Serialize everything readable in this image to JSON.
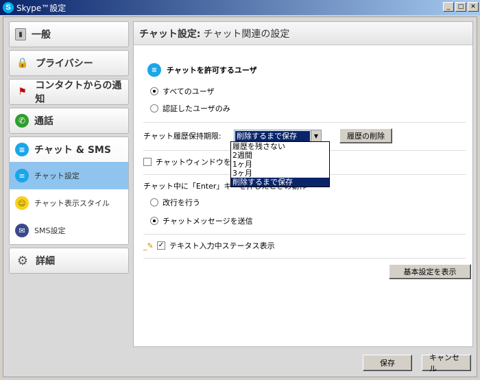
{
  "window": {
    "app_icon": "S",
    "title": "Skype™設定",
    "min": "_",
    "max": "□",
    "close": "✕"
  },
  "sidebar": {
    "general": "一般",
    "privacy": "プライバシー",
    "notifications": "コンタクトからの通知",
    "calls": "通話",
    "chat_sms": "チャット & SMS",
    "sub_items": [
      "チャット設定",
      "チャット表示スタイル",
      "SMS設定"
    ],
    "advanced": "詳細"
  },
  "panel": {
    "header_strong": "チャット設定:",
    "header_rest": "チャット関連の設定",
    "allow_title": "チャットを許可するユーザ",
    "radio_all": "すべてのユーザ",
    "radio_auth": "認証したユーザのみ",
    "history_label": "チャット履歴保持期限:",
    "history_value": "削除するまで保存",
    "history_options": [
      "履歴を残さない",
      "2週間",
      "1ヶ月",
      "3ヶ月",
      "削除するまで保存"
    ],
    "delete_history": "履歴の削除",
    "popup_check": "チャットウィンドウをポップア",
    "enter_title": "チャット中に「Enter」キーを押したときの動作",
    "radio_newline": "改行を行う",
    "radio_send": "チャットメッセージを送信",
    "typing_status": "テキスト入力中ステータス表示",
    "basic_settings": "基本設定を表示"
  },
  "footer": {
    "save": "保存",
    "cancel": "キャンセル"
  },
  "colors": {
    "selection": "#0a246a",
    "selected_nav": "#8fc4ef",
    "skype_blue": "#1aa6e8"
  }
}
